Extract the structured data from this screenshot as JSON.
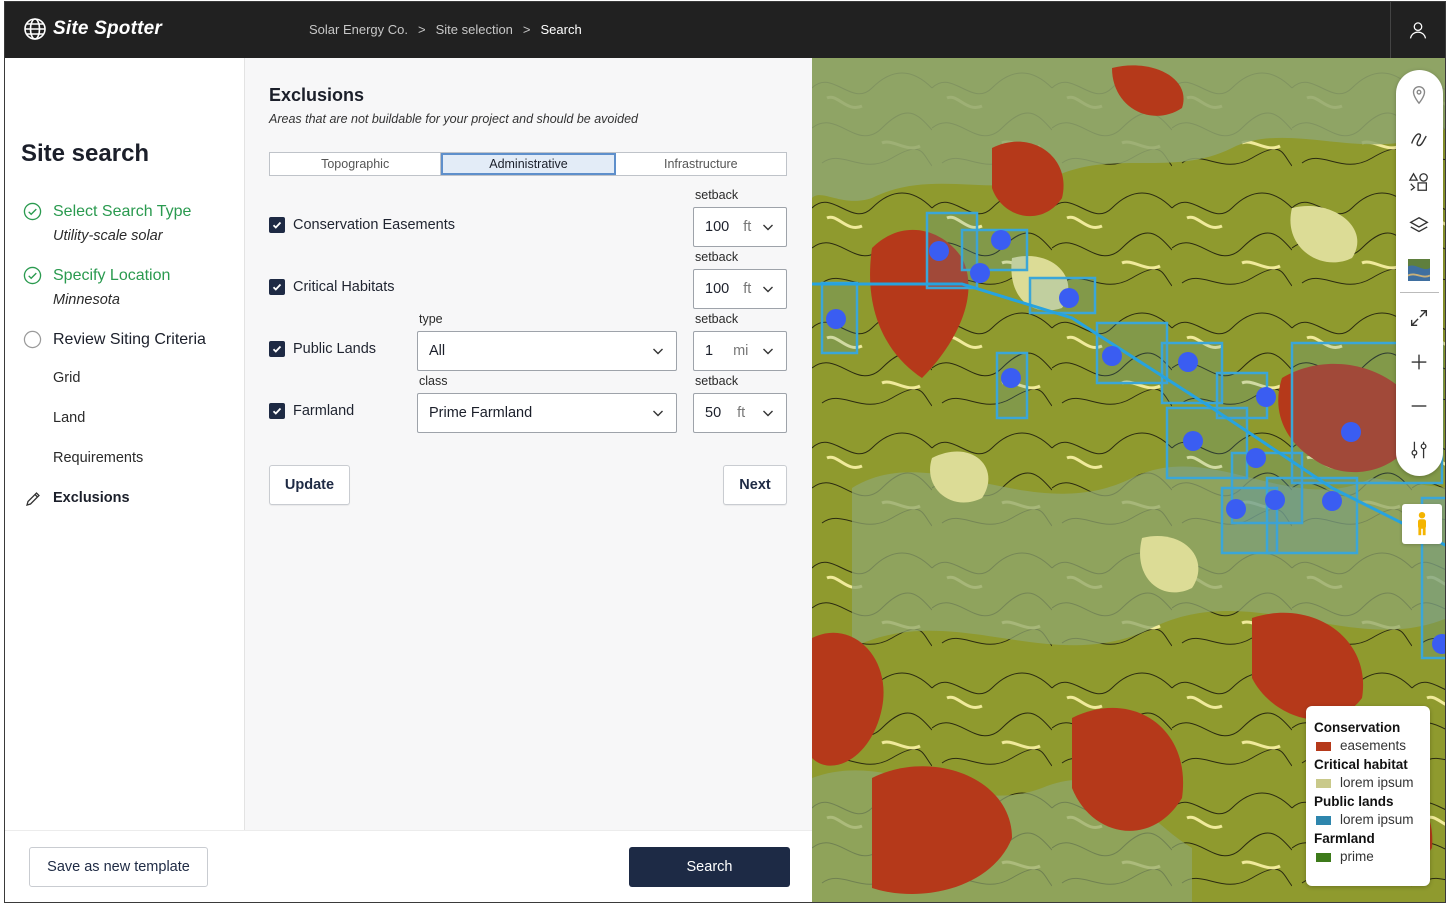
{
  "app": {
    "name": "Site Spotter"
  },
  "breadcrumb": [
    "Solar Energy Co.",
    "Site selection",
    "Search"
  ],
  "breadcrumb_sep": ">",
  "steps": {
    "title": "Site search",
    "items": [
      {
        "label": "Select Search Type",
        "subtitle": "Utility-scale solar",
        "status": "done"
      },
      {
        "label": "Specify Location",
        "subtitle": "Minnesota",
        "status": "done"
      },
      {
        "label": "Review Siting Criteria",
        "status": "pending"
      }
    ],
    "subitems": [
      "Grid",
      "Land",
      "Requirements",
      "Exclusions"
    ],
    "active_subitem": "Exclusions"
  },
  "form": {
    "title": "Exclusions",
    "description": "Areas that are not buildable for your project and should be avoided",
    "tabs": [
      "Topographic",
      "Administrative",
      "Infrastructure"
    ],
    "active_tab": "Administrative",
    "rows": [
      {
        "label": "Conservation Easements",
        "checked": true,
        "setback_label": "setback",
        "setback_value": "100",
        "setback_unit": "ft"
      },
      {
        "label": "Critical Habitats",
        "checked": true,
        "setback_label": "setback",
        "setback_value": "100",
        "setback_unit": "ft"
      },
      {
        "label": "Public Lands",
        "checked": true,
        "filter_label": "type",
        "filter_value": "All",
        "setback_label": "setback",
        "setback_value": "1",
        "setback_unit": "mi"
      },
      {
        "label": "Farmland",
        "checked": true,
        "filter_label": "class",
        "filter_value": "Prime Farmland",
        "setback_label": "setback",
        "setback_value": "50",
        "setback_unit": "ft"
      }
    ],
    "update_label": "Update",
    "next_label": "Next"
  },
  "footer": {
    "save_template_label": "Save as new template",
    "search_label": "Search"
  },
  "map": {
    "icons": [
      "pin-icon",
      "draw-line-icon",
      "shapes-icon",
      "layers-icon",
      "satellite-thumbnail-icon",
      "expand-icon",
      "zoom-in-icon",
      "zoom-out-icon",
      "filter-sliders-icon"
    ],
    "legend": [
      {
        "heading": "Conservation",
        "item": "easements",
        "color": "#b5391a"
      },
      {
        "heading": "Critical habitat",
        "item": "lorem ipsum",
        "color": "#c9c98a"
      },
      {
        "heading": "Public lands",
        "item": "lorem ipsum",
        "color": "#2e86ad"
      },
      {
        "heading": "Farmland",
        "item": "prime",
        "color": "#3d7a1a"
      }
    ],
    "colors": {
      "easement": "#b5391a",
      "habitat": "#dcdc96",
      "public": "#3aa6d8",
      "farm": "#8f9a2e",
      "marker": "#3a5df2"
    }
  }
}
